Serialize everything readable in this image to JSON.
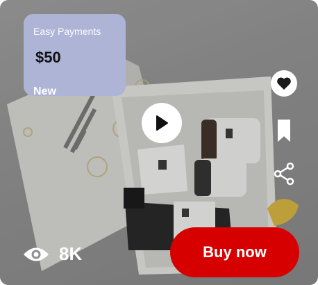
{
  "payment": {
    "title": "Easy Payments",
    "price": "$50",
    "badge": "New"
  },
  "actions": {
    "buy_label": "Buy now"
  },
  "stats": {
    "views": "8K"
  },
  "icons": [
    "play-icon",
    "heart-icon",
    "bookmark-icon",
    "share-icon",
    "eye-icon"
  ],
  "colors": {
    "buy_button": "#d60000",
    "payment_card": "#aeb4d6",
    "overlay": "#8f8f8f"
  }
}
